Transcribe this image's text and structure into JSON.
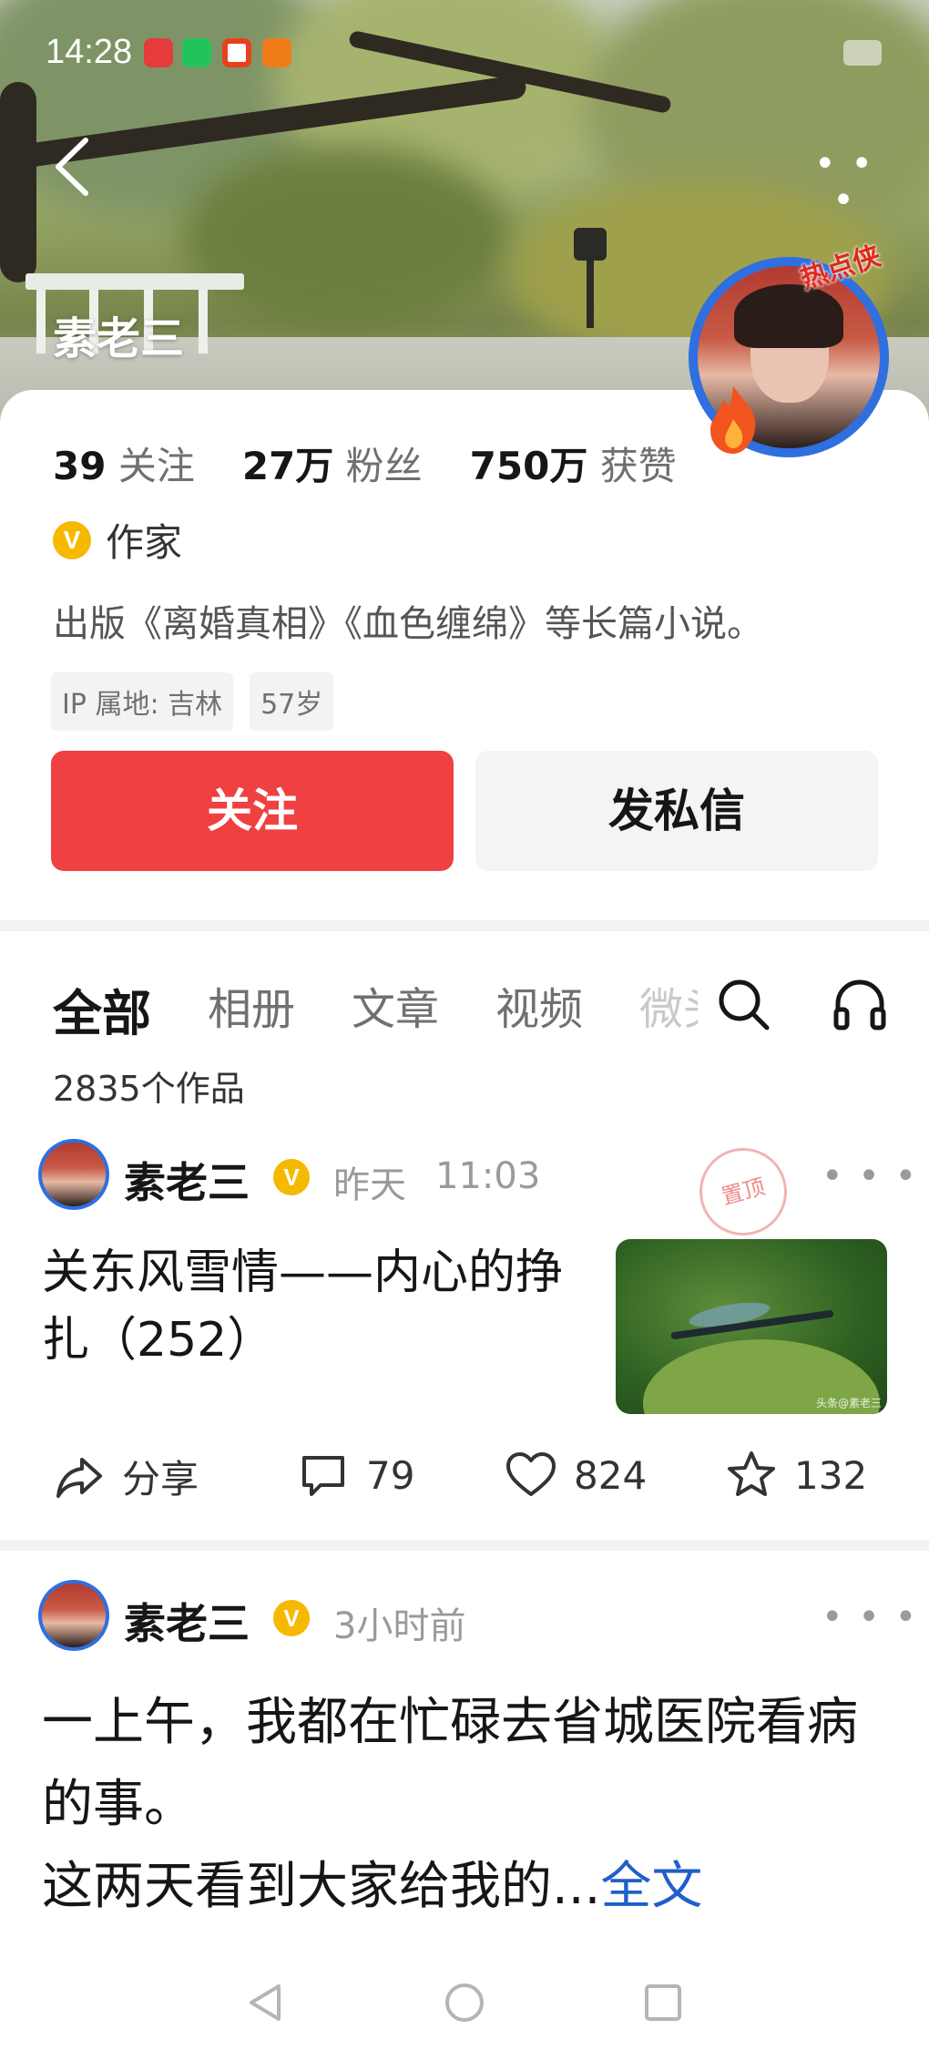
{
  "status_bar": {
    "time": "14:28",
    "notification_icons": [
      "huawei-video-icon",
      "wechat-icon",
      "news-app-icon",
      "browser-icon"
    ]
  },
  "header": {
    "more_label": "• • •"
  },
  "profile": {
    "name": "素老三",
    "hot_badge": "热点侠",
    "stats": [
      {
        "value": "39",
        "label": "关注"
      },
      {
        "value": "27万",
        "label": "粉丝"
      },
      {
        "value": "750万",
        "label": "获赞"
      }
    ],
    "verify_mark": "V",
    "verified_title": "作家",
    "bio": "出版《离婚真相》《血色缠绵》等长篇小说。",
    "tags": [
      "IP 属地: 吉林",
      "57岁"
    ],
    "follow_button": "关注",
    "message_button": "发私信"
  },
  "tabs": {
    "items": [
      "全部",
      "相册",
      "文章",
      "视频",
      "微头条"
    ],
    "active": "全部",
    "works_count": "2835个作品"
  },
  "posts": [
    {
      "author": "素老三",
      "verify_mark": "V",
      "date": "昨天",
      "time": "11:03",
      "pinned_stamp": "置顶",
      "title": "关东风雪情——内心的挣扎（252）",
      "thumbnail_watermark": "头条@素老三",
      "share_label": "分享",
      "comments": "79",
      "likes": "824",
      "favorites": "132",
      "more": "• • •"
    },
    {
      "author": "素老三",
      "verify_mark": "V",
      "time": "3小时前",
      "body": "一上午，我都在忙碌去省城医院看病的事。\n这两天看到大家给我的...",
      "full_text_link": "全文",
      "more": "• • •"
    }
  ],
  "colors": {
    "accent_red": "#f04142",
    "verify_gold": "#f5b900",
    "link_blue": "#1f5fc9",
    "avatar_ring": "#2f6fe0"
  }
}
